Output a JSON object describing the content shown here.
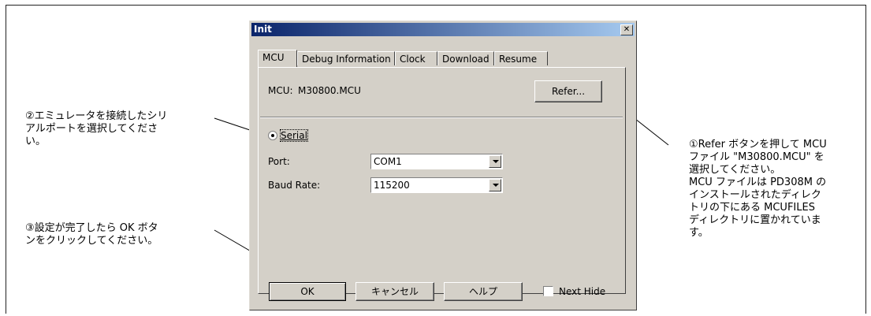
{
  "annotations": {
    "note1": "①Refer ボタンを押して MCU\nファイル \"M30800.MCU\" を\n選択してください。\nMCU ファイルは PD308M の\nインストールされたディレク\nトリの下にある MCUFILES\nディレクトリに置かれていま\nす。",
    "note2": "②エミュレータを接続したシリ\nアルポートを選択してくださ\nい。",
    "note3": "③設定が完了したら OK ボタ\nンをクリックしてください。"
  },
  "dialog": {
    "title": "Init",
    "close_glyph": "✕",
    "tabs": [
      "MCU",
      "Debug Information",
      "Clock",
      "Download",
      "Resume"
    ],
    "mcu_label": "MCU:",
    "mcu_value": "M30800.MCU",
    "refer_label": "Refer...",
    "serial_label": "Serial",
    "port_label": "Port:",
    "port_value": "COM1",
    "baud_label": "Baud Rate:",
    "baud_value": "115200",
    "ok_label": "OK",
    "cancel_label": "キャンセル",
    "help_label": "ヘルプ",
    "next_hide_label": "Next Hide",
    "next_hide_checked": false,
    "serial_selected": true
  },
  "icons": {
    "close": "close-icon",
    "dropdown": "chevron-down-icon",
    "radio": "radio-icon",
    "checkbox": "checkbox-icon"
  }
}
